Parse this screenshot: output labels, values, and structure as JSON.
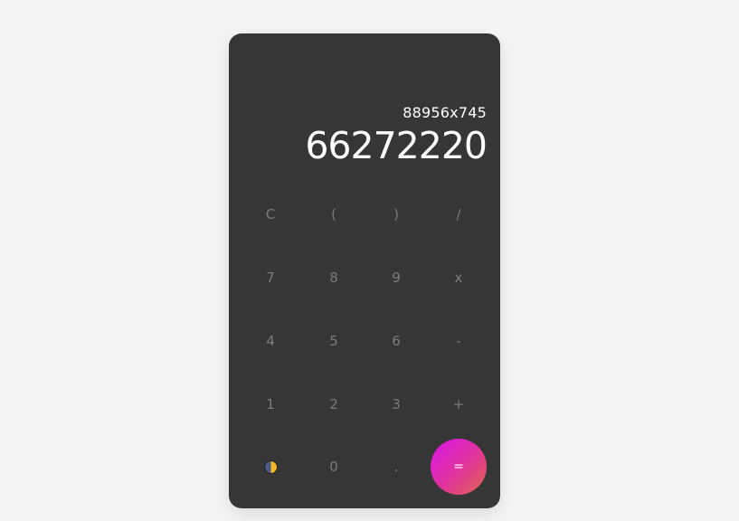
{
  "display": {
    "expression": "88956x745",
    "result": "66272220"
  },
  "keys": {
    "clear": "C",
    "open_paren": "(",
    "close_paren": ")",
    "divide": "/",
    "seven": "7",
    "eight": "8",
    "nine": "9",
    "multiply": "x",
    "four": "4",
    "five": "5",
    "six": "6",
    "minus": "-",
    "one": "1",
    "two": "2",
    "three": "3",
    "plus": "+",
    "zero": "0",
    "decimal": ".",
    "equals": "="
  },
  "theme_toggle": {
    "icon": "half-moon-sun-icon"
  },
  "colors": {
    "background": "#f4f4f4",
    "panel": "#363636",
    "key_text": "#7b7b7b",
    "display_text": "#ffffff",
    "equals_gradient_start": "#d816e8",
    "equals_gradient_end": "#df6a4a"
  }
}
